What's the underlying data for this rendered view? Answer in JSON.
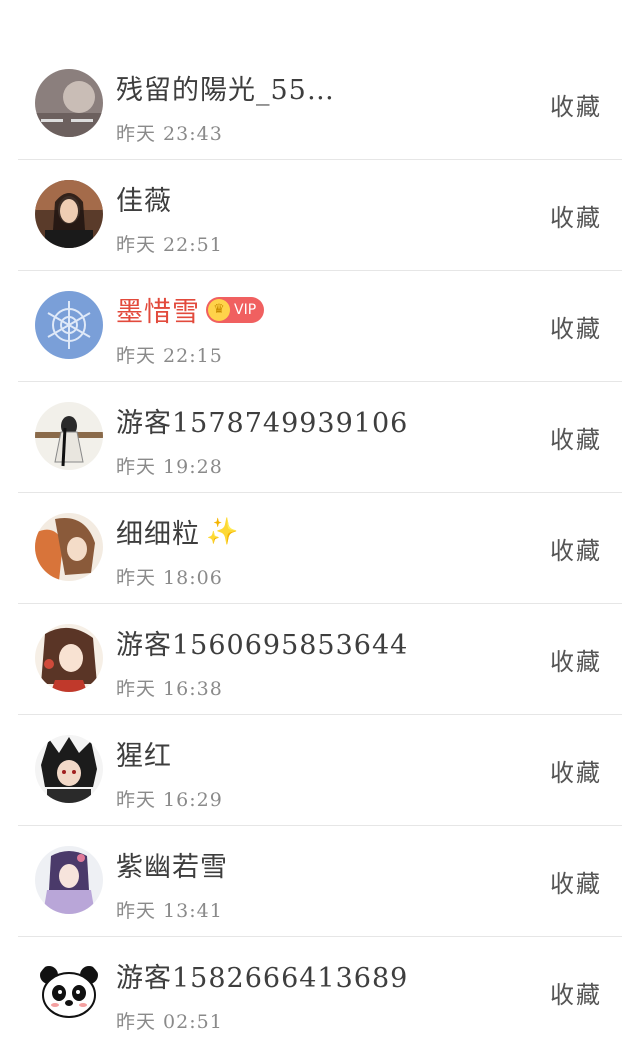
{
  "fav_label": "收藏",
  "rows": [
    {
      "name": "残留的陽光_55…",
      "time": "昨天 23:43",
      "avatar": "gray-photo"
    },
    {
      "name": "佳薇",
      "time": "昨天 22:51",
      "avatar": "woman-photo"
    },
    {
      "name": "墨惜雪",
      "time": "昨天 22:15",
      "avatar": "snowflake",
      "vip": true,
      "vip_label": "VIP",
      "vip_crown_icon": "crown-icon"
    },
    {
      "name": "游客1578749939106",
      "time": "昨天 19:28",
      "avatar": "ink-figure"
    },
    {
      "name": "细细粒",
      "time": "昨天 18:06",
      "avatar": "anime-girl-brown",
      "emoji": "✨"
    },
    {
      "name": "游客1560695853644",
      "time": "昨天 16:38",
      "avatar": "anime-girl-red"
    },
    {
      "name": "猩红",
      "time": "昨天 16:29",
      "avatar": "anime-boy-dark"
    },
    {
      "name": "紫幽若雪",
      "time": "昨天 13:41",
      "avatar": "anime-girl-purple"
    },
    {
      "name": "游客1582666413689",
      "time": "昨天 02:51",
      "avatar": "panda"
    }
  ],
  "colors": {
    "vip_name": "#e24a3c",
    "divider": "#e6e6e6",
    "vip_badge": "#f06060"
  }
}
